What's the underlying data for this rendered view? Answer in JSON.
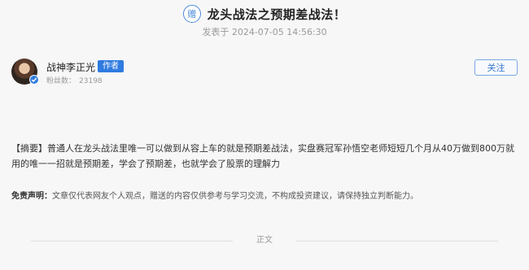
{
  "article": {
    "badge_char": "赠",
    "title": "龙头战法之预期差战法！",
    "post_time": "发表于 2024-07-05 14:56:30"
  },
  "author": {
    "name": "战神李正光",
    "tag": "作者",
    "fans_label": "粉丝数：",
    "fans_count": "23198",
    "follow_label": "关注"
  },
  "summary": {
    "text": "【摘要】普通人在龙头战法里唯一可以做到从容上车的就是预期差战法，实盘赛冠军孙悟空老师短短几个月从40万做到800万就用的唯一一招就是预期差，学会了预期差，也就学会了股票的理解力"
  },
  "disclaimer": {
    "label": "免责声明：",
    "text": "文章仅代表网友个人观点，赠送的内容仅供参考与学习交流，不构成投资建议，请保持独立判断能力。"
  },
  "divider": {
    "text": "正文"
  },
  "colors": {
    "accent": "#2f7be0",
    "background": "#f7f7f7"
  },
  "icons": {
    "badge": "gift-badge-icon",
    "verified": "verified-check-icon"
  }
}
